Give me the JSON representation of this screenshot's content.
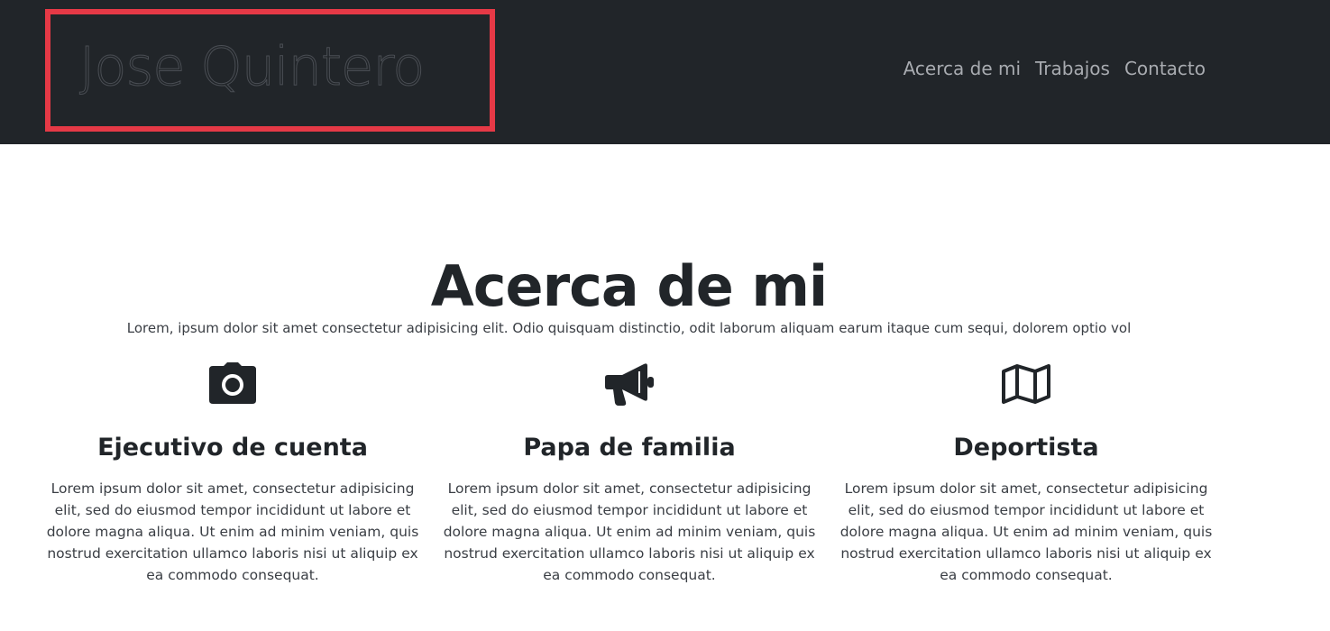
{
  "header": {
    "brand": "Jose Quintero",
    "nav": [
      "Acerca de mi",
      "Trabajos",
      "Contacto"
    ]
  },
  "about": {
    "title": "Acerca de mi",
    "text": "Lorem, ipsum dolor sit amet consectetur adipisicing elit. Odio quisquam distinctio, odit laborum aliquam earum itaque cum sequi, dolorem optio vol"
  },
  "features": [
    {
      "icon": "camera-icon",
      "title": "Ejecutivo de cuenta",
      "text": "Lorem ipsum dolor sit amet, consectetur adipisicing elit, sed do eiusmod tempor incididunt ut labore et dolore magna aliqua. Ut enim ad minim veniam, quis nostrud exercitation ullamco laboris nisi ut aliquip ex ea commodo consequat."
    },
    {
      "icon": "megaphone-icon",
      "title": "Papa de familia",
      "text": "Lorem ipsum dolor sit amet, consectetur adipisicing elit, sed do eiusmod tempor incididunt ut labore et dolore magna aliqua. Ut enim ad minim veniam, quis nostrud exercitation ullamco laboris nisi ut aliquip ex ea commodo consequat."
    },
    {
      "icon": "map-icon",
      "title": "Deportista",
      "text": "Lorem ipsum dolor sit amet, consectetur adipisicing elit, sed do eiusmod tempor incididunt ut labore et dolore magna aliqua. Ut enim ad minim veniam, quis nostrud exercitation ullamco laboris nisi ut aliquip ex ea commodo consequat."
    }
  ],
  "colors": {
    "navbar": "#212529",
    "highlight": "#e63946",
    "nav_link": "#a8abb0"
  }
}
